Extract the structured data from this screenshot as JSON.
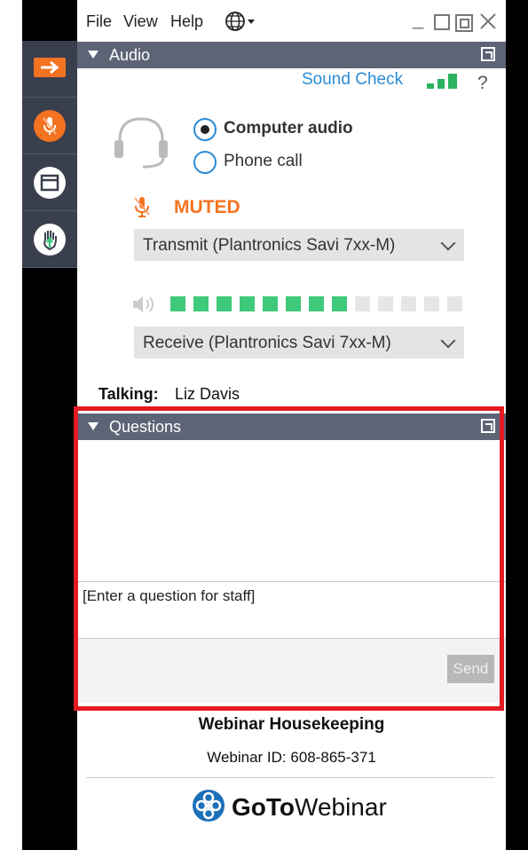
{
  "menu": {
    "file": "File",
    "view": "View",
    "help": "Help"
  },
  "audio": {
    "header": "Audio",
    "sound_check": "Sound Check",
    "help_glyph": "?",
    "options": [
      {
        "label": "Computer audio",
        "selected": true
      },
      {
        "label": "Phone call",
        "selected": false
      }
    ],
    "muted_label": "MUTED",
    "transmit_device": "Transmit (Plantronics Savi 7xx-M)",
    "receive_device": "Receive (Plantronics Savi 7xx-M)",
    "volume_level": "8/13",
    "talking_label": "Talking:",
    "talking_name": "Liz Davis"
  },
  "questions": {
    "header": "Questions",
    "input_placeholder": "[Enter a question for staff]",
    "send_label": "Send"
  },
  "footer": {
    "title": "Webinar Housekeeping",
    "webinar_id": "Webinar ID: 608-865-371",
    "brand_bold": "GoTo",
    "brand_light": "Webinar"
  },
  "colors": {
    "accent_orange": "#f47321",
    "header_bar": "#5d6476",
    "link_blue": "#2a8cd6",
    "meter_green": "#3ec97b",
    "highlight_red": "#e31b23"
  },
  "icons": [
    "arrow-right-icon",
    "microphone-muted-icon",
    "window-icon",
    "hand-raise-icon",
    "headset-icon",
    "globe-icon",
    "speaker-icon",
    "signal-bars-icon",
    "gotowebinar-logo-icon"
  ]
}
